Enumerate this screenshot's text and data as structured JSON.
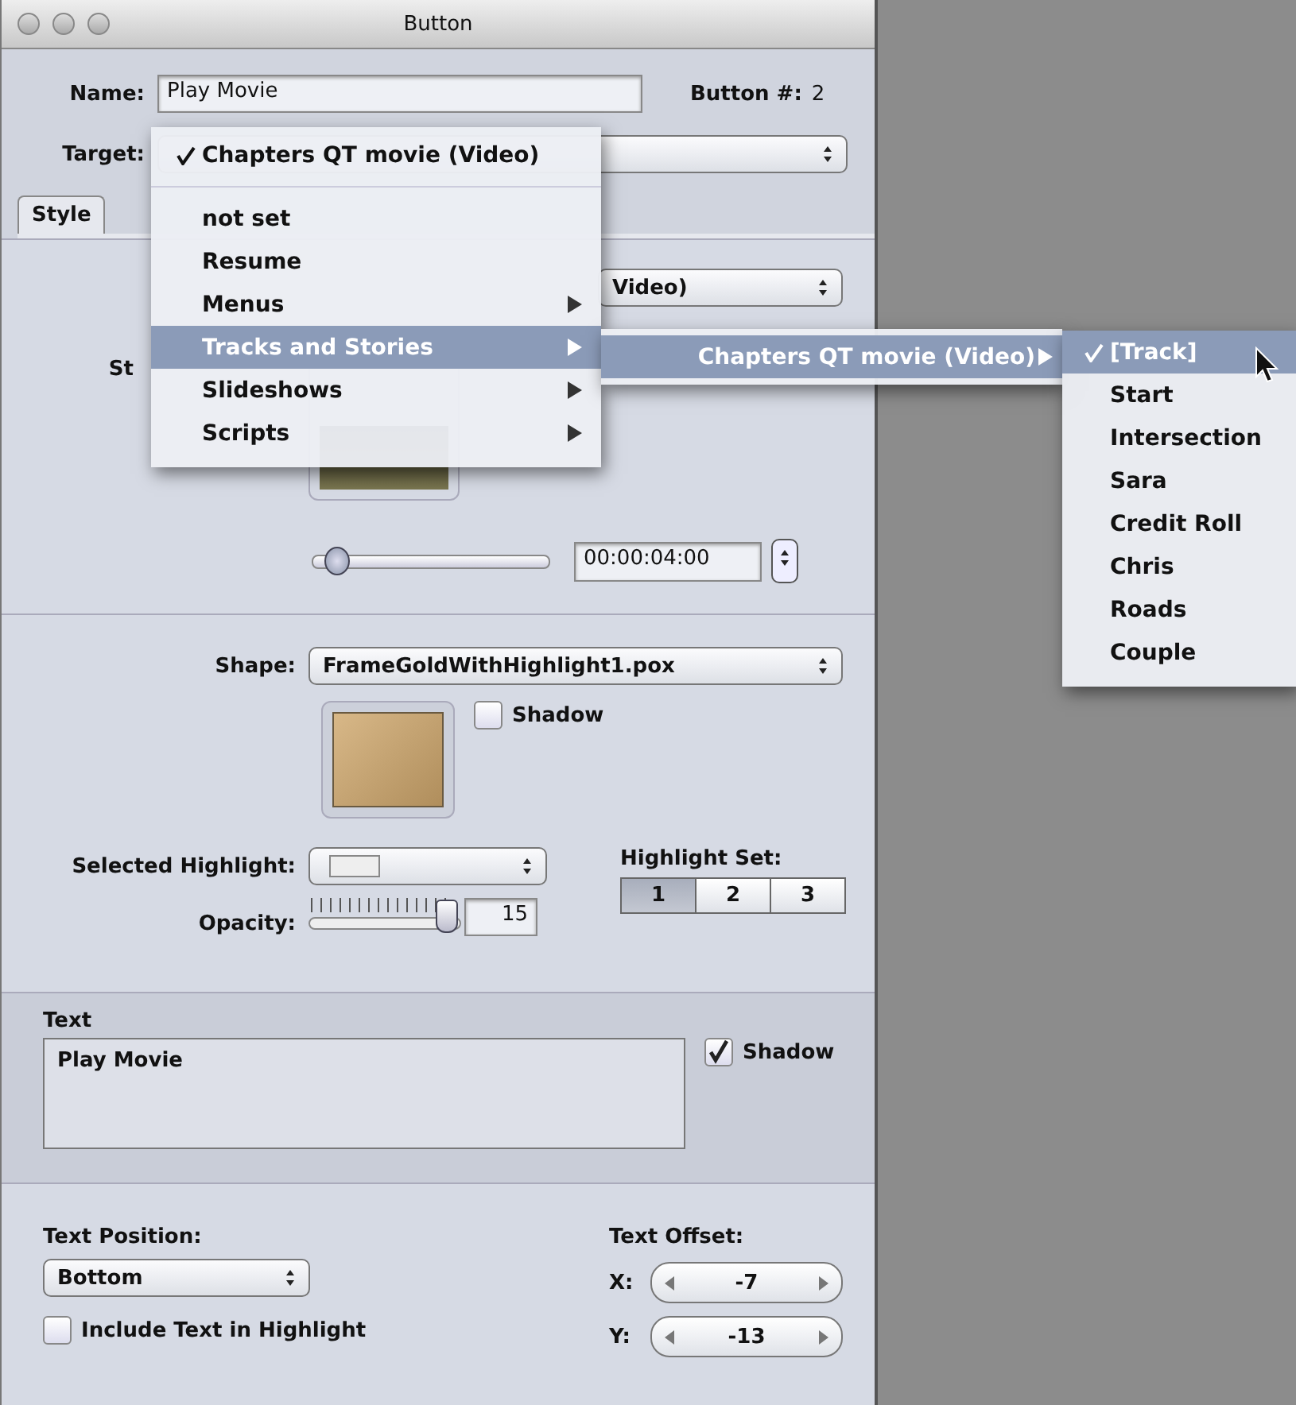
{
  "window": {
    "title": "Button"
  },
  "name": {
    "label": "Name:",
    "value": "Play Movie"
  },
  "button_number": {
    "label": "Button #:",
    "value": "2"
  },
  "target": {
    "label": "Target:"
  },
  "tabs": [
    {
      "label": "Style",
      "selected": true
    }
  ],
  "asset": {
    "value": "Video)"
  },
  "start_frame": {
    "label": "St",
    "level": 0.05,
    "timecode": "00:00:04:00"
  },
  "shape": {
    "label": "Shape:",
    "value": "FrameGoldWithHighlight1.pox",
    "shadow": {
      "label": "Shadow",
      "checked": false
    }
  },
  "selected_highlight": {
    "label": "Selected Highlight:"
  },
  "opacity": {
    "label": "Opacity:",
    "level": 0.93,
    "value": "15"
  },
  "highlight_set": {
    "label": "Highlight Set:",
    "buttons": [
      {
        "label": "1",
        "selected": true
      },
      {
        "label": "2",
        "selected": false
      },
      {
        "label": "3",
        "selected": false
      }
    ]
  },
  "text": {
    "title": "Text",
    "value": "Play Movie",
    "shadow": {
      "label": "Shadow",
      "checked": true
    }
  },
  "text_position": {
    "label": "Text Position:",
    "value": "Bottom"
  },
  "include_text": {
    "label": "Include Text in Highlight",
    "checked": false
  },
  "text_offset": {
    "label": "Text Offset:",
    "x": {
      "label": "X:",
      "value": "-7"
    },
    "y": {
      "label": "Y:",
      "value": "-13"
    }
  },
  "menu": {
    "items": [
      {
        "kind": "item",
        "label": "Chapters QT movie (Video)",
        "checked": true,
        "submenu": false,
        "selected": false
      },
      {
        "kind": "separator"
      },
      {
        "kind": "item",
        "label": "not set",
        "checked": false,
        "submenu": false,
        "selected": false
      },
      {
        "kind": "item",
        "label": "Resume",
        "checked": false,
        "submenu": false,
        "selected": false
      },
      {
        "kind": "item",
        "label": "Menus",
        "checked": false,
        "submenu": true,
        "selected": false
      },
      {
        "kind": "item",
        "label": "Tracks and Stories",
        "checked": false,
        "submenu": true,
        "selected": true
      },
      {
        "kind": "item",
        "label": "Slideshows",
        "checked": false,
        "submenu": true,
        "selected": false
      },
      {
        "kind": "item",
        "label": "Scripts",
        "checked": false,
        "submenu": true,
        "selected": false
      }
    ]
  },
  "submenu": {
    "items": [
      {
        "label": "Chapters QT movie (Video)",
        "submenu": true,
        "selected": true
      }
    ]
  },
  "track_menu": {
    "items": [
      {
        "label": "[Track]",
        "checked": true,
        "selected": true
      },
      {
        "label": "Start",
        "checked": false,
        "selected": false
      },
      {
        "label": "Intersection",
        "checked": false,
        "selected": false
      },
      {
        "label": "Sara",
        "checked": false,
        "selected": false
      },
      {
        "label": "Credit Roll",
        "checked": false,
        "selected": false
      },
      {
        "label": "Chris",
        "checked": false,
        "selected": false
      },
      {
        "label": "Roads",
        "checked": false,
        "selected": false
      },
      {
        "label": "Couple",
        "checked": false,
        "selected": false
      }
    ]
  }
}
